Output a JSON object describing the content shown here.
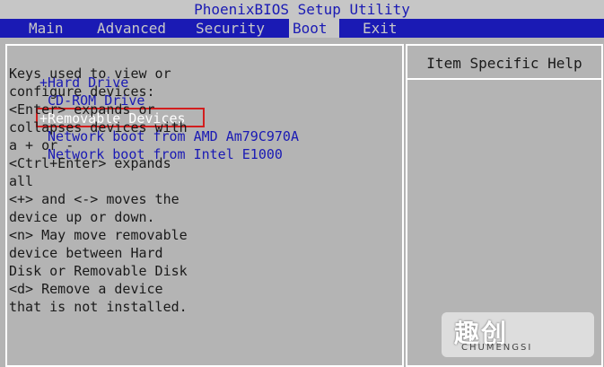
{
  "title": "PhoenixBIOS Setup Utility",
  "menu": {
    "items": [
      {
        "label": "Main"
      },
      {
        "label": "Advanced"
      },
      {
        "label": "Security"
      },
      {
        "label": "Boot",
        "active": true
      },
      {
        "label": "Exit"
      }
    ]
  },
  "boot": {
    "items": [
      {
        "label": "+Hard Drive"
      },
      {
        "label": " CD-ROM Drive"
      },
      {
        "label": "+Removable Devices",
        "selected": true
      },
      {
        "label": " Network boot from AMD Am79C970A"
      },
      {
        "label": " Network boot from Intel E1000"
      }
    ]
  },
  "help": {
    "header": "Item Specific Help",
    "lines": [
      "Keys used to view or",
      "configure devices:",
      "<Enter> expands or",
      "collapses devices with",
      "a + or -",
      "<Ctrl+Enter> expands",
      "all",
      "<+> and <-> moves the",
      "device up or down.",
      "<n> May move removable",
      "device between Hard",
      "Disk or Removable Disk",
      "<d> Remove a device",
      "that is not installed."
    ]
  },
  "watermark": {
    "logo": "趣创",
    "sub": "CHUMENGSI"
  },
  "colors": {
    "bios_blue": "#1a1ab4",
    "background": "#b4b4b4",
    "highlight": "#d21e1e"
  }
}
